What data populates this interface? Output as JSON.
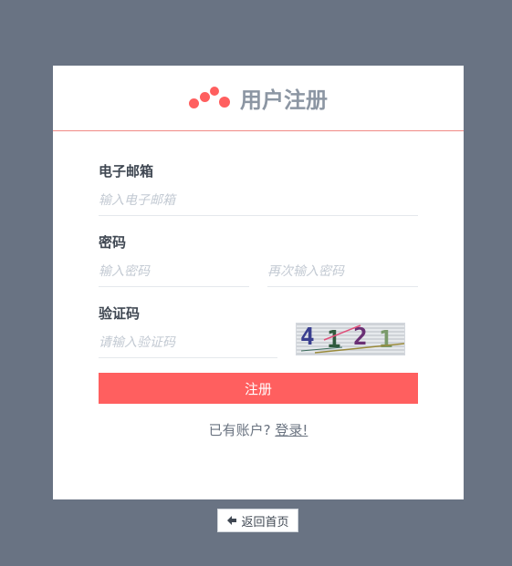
{
  "header": {
    "title": "用户注册",
    "brand_color": "#ff5f5f"
  },
  "form": {
    "email": {
      "label": "电子邮箱",
      "placeholder": "输入电子邮箱",
      "value": ""
    },
    "password": {
      "label": "密码",
      "placeholder": "输入密码",
      "confirm_placeholder": "再次输入密码"
    },
    "captcha": {
      "label": "验证码",
      "placeholder": "请输入验证码",
      "image_text": [
        "4",
        "1",
        "2",
        "1"
      ]
    },
    "submit_label": "注册"
  },
  "login_prompt": {
    "text": "已有账户?",
    "link_label": "登录!"
  },
  "back_button": {
    "label": "返回首页",
    "icon": "arrow-left-icon"
  },
  "colors": {
    "page_background": "#697383",
    "accent": "#ff5f5f"
  }
}
